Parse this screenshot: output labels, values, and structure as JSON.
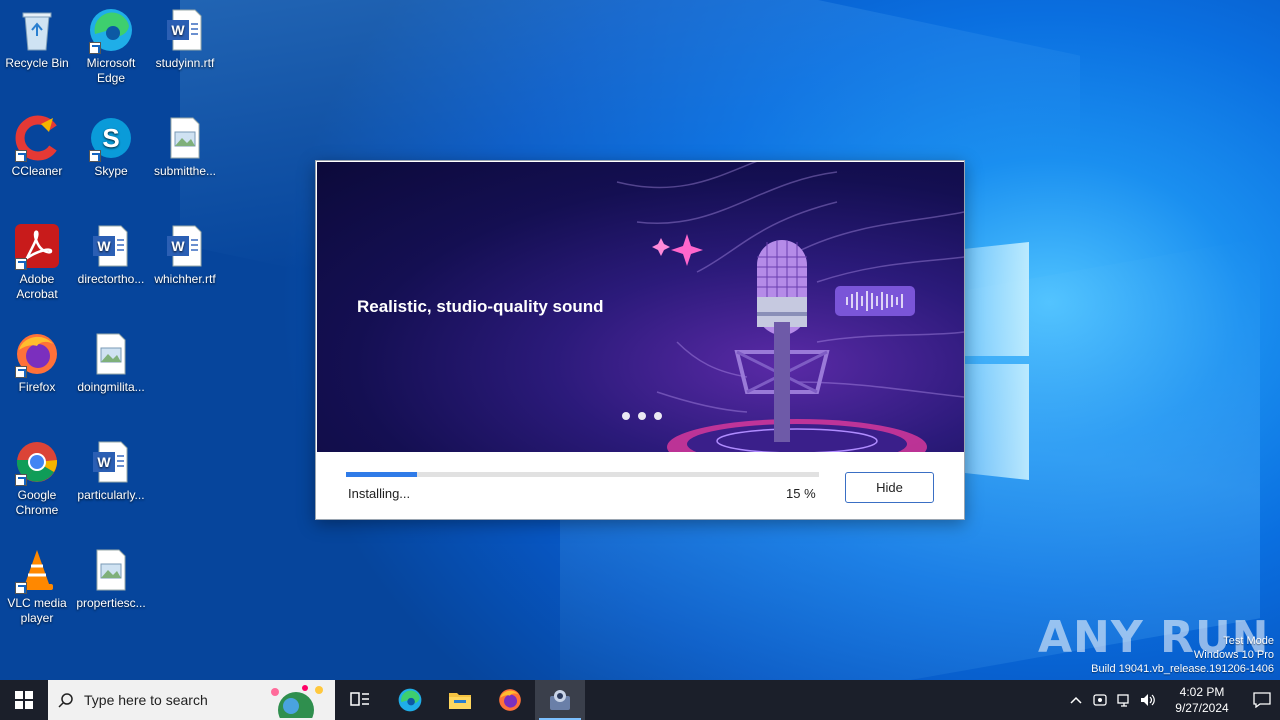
{
  "desktop": {
    "icons": [
      {
        "label": "Recycle Bin"
      },
      {
        "label": "Microsoft Edge"
      },
      {
        "label": "studyinn.rtf"
      },
      {
        "label": "CCleaner"
      },
      {
        "label": "Skype"
      },
      {
        "label": "submitthe..."
      },
      {
        "label": "Adobe Acrobat"
      },
      {
        "label": "directortho..."
      },
      {
        "label": "whichher.rtf"
      },
      {
        "label": "Firefox"
      },
      {
        "label": "doingmilita..."
      },
      {
        "label": "Google Chrome"
      },
      {
        "label": "particularly..."
      },
      {
        "label": "VLC media player"
      },
      {
        "label": "propertiesc..."
      }
    ]
  },
  "installer": {
    "banner_text": "Realistic, studio-quality sound",
    "status": "Installing...",
    "progress_percent": 15,
    "progress_label": "15 %",
    "hide_label": "Hide",
    "carousel_dots": 3
  },
  "watermark": {
    "brand": "ANY RUN",
    "line1": "Test Mode",
    "line2": "Windows 10 Pro",
    "line3": "Build 19041.vb_release.191206-1406"
  },
  "taskbar": {
    "search_placeholder": "Type here to search",
    "pinned": [
      "task-view",
      "edge",
      "file-explorer",
      "firefox",
      "installer-app"
    ],
    "time": "4:02 PM",
    "date": "9/27/2024"
  },
  "colors": {
    "progress": "#2f7be8",
    "taskbar": "#1b1f2a",
    "desktop_accent": "#0a6fe0"
  }
}
